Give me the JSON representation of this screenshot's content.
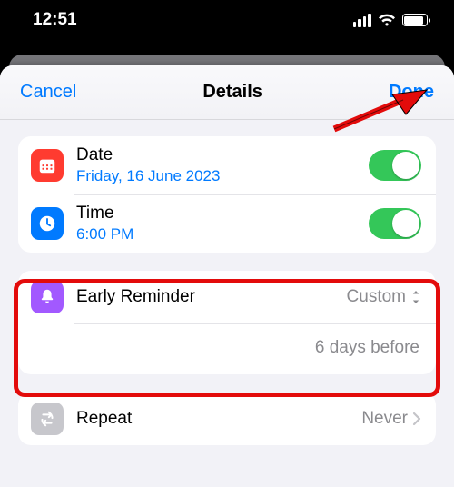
{
  "status": {
    "time": "12:51"
  },
  "sheet": {
    "cancel": "Cancel",
    "title": "Details",
    "done": "Done"
  },
  "date": {
    "label": "Date",
    "value": "Friday, 16 June 2023"
  },
  "time": {
    "label": "Time",
    "value": "6:00 PM"
  },
  "reminder": {
    "label": "Early Reminder",
    "value": "Custom",
    "detail": "6 days before"
  },
  "repeat": {
    "label": "Repeat",
    "value": "Never"
  }
}
